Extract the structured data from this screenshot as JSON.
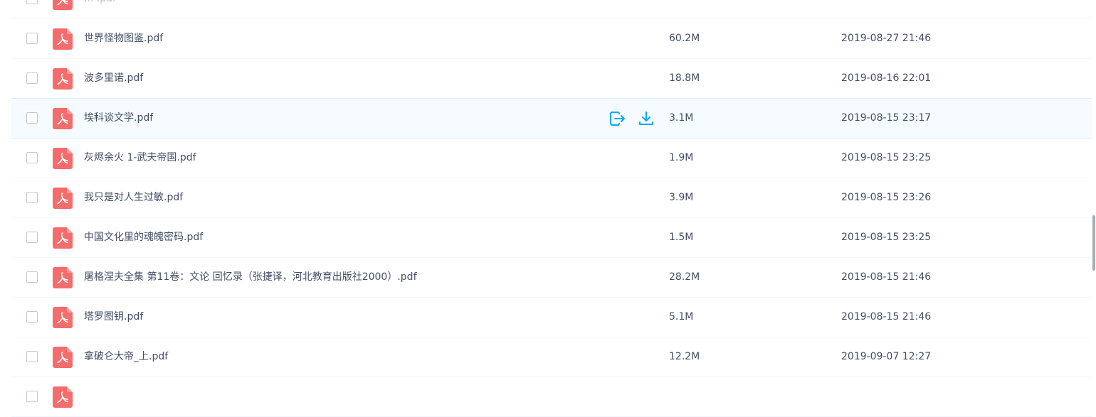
{
  "files": [
    {
      "name": "... .pdf",
      "size": "",
      "date": "",
      "partial": true
    },
    {
      "name": "世界怪物图鉴.pdf",
      "size": "60.2M",
      "date": "2019-08-27 21:46"
    },
    {
      "name": "波多里诺.pdf",
      "size": "18.8M",
      "date": "2019-08-16 22:01"
    },
    {
      "name": "埃科谈文学.pdf",
      "size": "3.1M",
      "date": "2019-08-15 23:17",
      "hover": true
    },
    {
      "name": "灰烬余火 1-武夫帝国.pdf",
      "size": "1.9M",
      "date": "2019-08-15 23:25"
    },
    {
      "name": "我只是对人生过敏.pdf",
      "size": "3.9M",
      "date": "2019-08-15 23:26"
    },
    {
      "name": "中国文化里的魂魄密码.pdf",
      "size": "1.5M",
      "date": "2019-08-15 23:25"
    },
    {
      "name": "屠格涅夫全集 第11卷：文论 回忆录（张捷译，河北教育出版社2000）.pdf",
      "size": "28.2M",
      "date": "2019-08-15 21:46"
    },
    {
      "name": "塔罗图钥.pdf",
      "size": "5.1M",
      "date": "2019-08-15 21:46"
    },
    {
      "name": "拿破仑大帝_上.pdf",
      "size": "12.2M",
      "date": "2019-09-07 12:27"
    },
    {
      "name": "",
      "size": "",
      "date": "",
      "partial": true
    }
  ],
  "icons": {
    "file_type": "pdf-file-icon",
    "share": "share-icon",
    "download": "download-icon"
  },
  "colors": {
    "pdf_red": "#f56c6c",
    "action_blue": "#06a7ff",
    "text": "#424e67",
    "hover_bg": "#f6fbff"
  }
}
